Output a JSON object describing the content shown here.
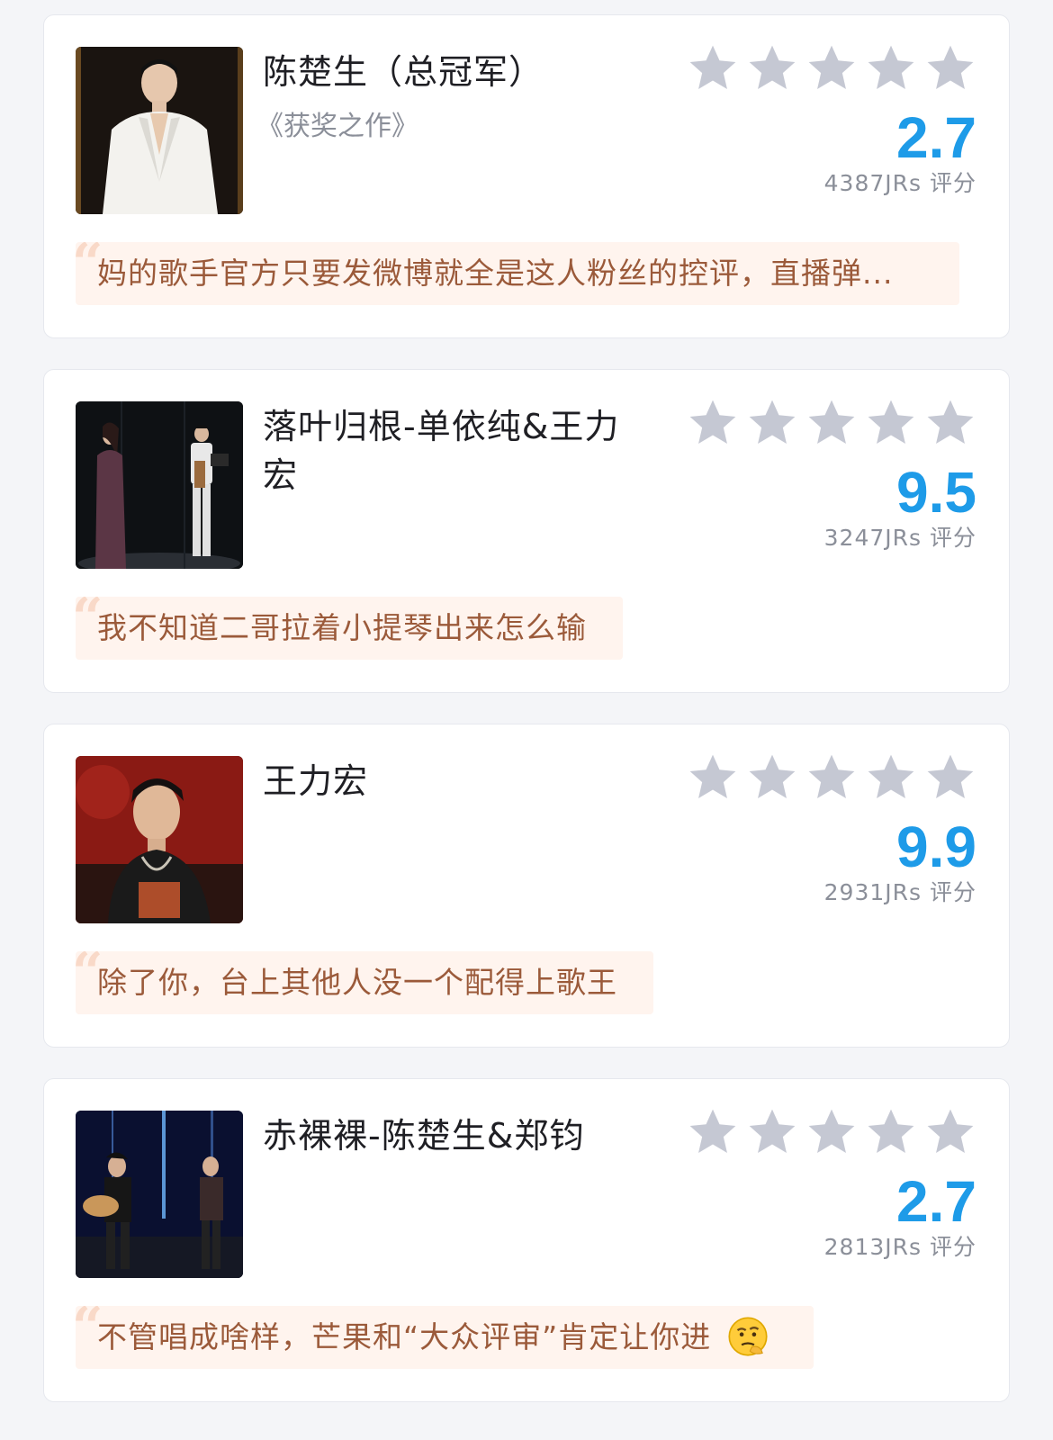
{
  "colors": {
    "score": "#1e9be8",
    "star_empty": "#c5c8d3",
    "comment_bg": "#fff4ee",
    "comment_text": "#9b5a3a"
  },
  "items": [
    {
      "title": "陈楚生（总冠军）",
      "subtitle": "《获奖之作》",
      "rating_stars": 0,
      "score": "2.7",
      "count": "4387JRs 评分",
      "comment": "妈的歌手官方只要发微博就全是这人粉丝的控评，直播弹...",
      "thumb_icon": "singer-white-suit-photo"
    },
    {
      "title": "落叶归根-单依纯&王力宏",
      "subtitle": "",
      "rating_stars": 0,
      "score": "9.5",
      "count": "3247JRs 评分",
      "comment": "我不知道二哥拉着小提琴出来怎么输",
      "thumb_icon": "duet-stage-photo"
    },
    {
      "title": "王力宏",
      "subtitle": "",
      "rating_stars": 0,
      "score": "9.9",
      "count": "2931JRs 评分",
      "comment": "除了你，台上其他人没一个配得上歌王",
      "thumb_icon": "singer-red-backdrop-photo"
    },
    {
      "title": "赤裸裸-陈楚生&郑钧",
      "subtitle": "",
      "rating_stars": 0,
      "score": "2.7",
      "count": "2813JRs 评分",
      "comment": "不管唱成啥样，芒果和“大众评审”肯定让你进",
      "comment_emoji": "thinking-face-emoji",
      "thumb_icon": "guitar-duo-stage-photo"
    }
  ]
}
